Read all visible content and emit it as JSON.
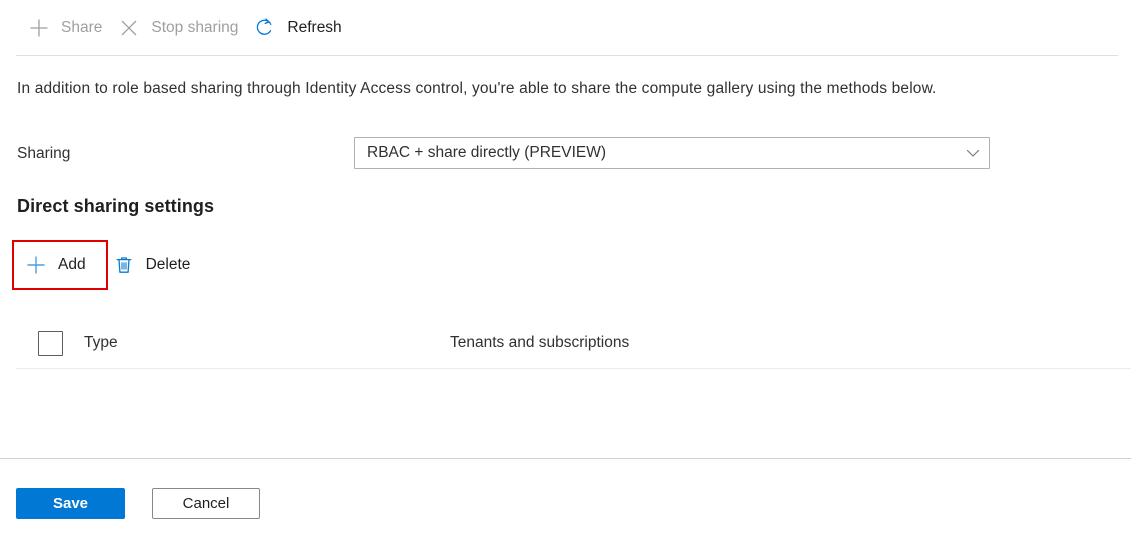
{
  "toolbar": {
    "items": [
      {
        "label": "Share",
        "icon": "plus-icon",
        "disabled": true
      },
      {
        "label": "Stop sharing",
        "icon": "close-x-icon",
        "disabled": true
      },
      {
        "label": "Refresh",
        "icon": "refresh-icon",
        "disabled": false
      }
    ],
    "share_label": "Share",
    "stop_sharing_label": "Stop sharing",
    "refresh_label": "Refresh"
  },
  "description": "In addition to role based sharing through Identity Access control, you're able to share the compute gallery using the methods below.",
  "sharing": {
    "label": "Sharing",
    "selected_option": "RBAC + share directly (PREVIEW)",
    "chevron_icon": "chevron-down-icon"
  },
  "direct_sharing": {
    "title": "Direct sharing settings",
    "add_label": "Add",
    "add_icon": "plus-icon",
    "delete_label": "Delete",
    "delete_icon": "trash-icon",
    "highlight_color": "#e00000"
  },
  "table": {
    "columns": [
      "Type",
      "Tenants and subscriptions"
    ],
    "select_all_checked": false,
    "rows": []
  },
  "footer": {
    "save_label": "Save",
    "cancel_label": "Cancel",
    "primary_color": "#0078d4"
  },
  "colors": {
    "accent": "#0078d4",
    "icon_blue": "#0078d4",
    "text": "#323130",
    "disabled_text": "#a19f9d",
    "highlight": "#e00000"
  }
}
